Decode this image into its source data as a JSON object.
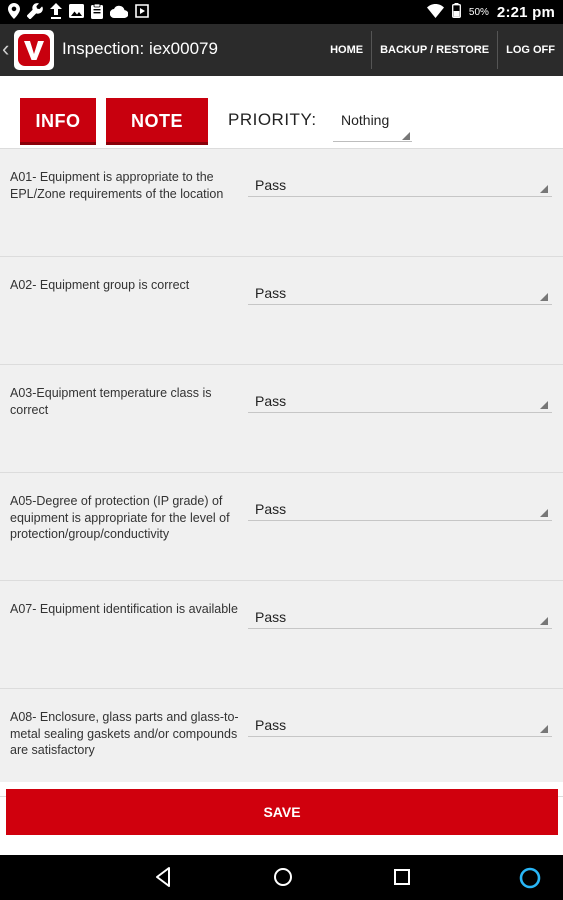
{
  "status_bar": {
    "battery": "50%",
    "time": "2:21 pm",
    "left_icons": [
      "location-pin-icon",
      "wrench-icon",
      "upload-icon",
      "image-icon",
      "clipboard-icon",
      "cloud-icon",
      "media-icon"
    ],
    "right_icons": [
      "wifi-icon",
      "battery-icon"
    ]
  },
  "app_bar": {
    "title": "Inspection: iex00079",
    "menu": [
      "HOME",
      "BACKUP / RESTORE",
      "LOG OFF"
    ],
    "colors": {
      "background": "#2b2b2b",
      "logo_red": "#c8000e"
    }
  },
  "tabs": {
    "info_label": "INFO",
    "note_label": "NOTE",
    "priority_label": "PRIORITY:",
    "priority_value": "Nothing"
  },
  "checklist": [
    {
      "question": "A01- Equipment is appropriate to the EPL/Zone requirements of the location",
      "result": "Pass"
    },
    {
      "question": "A02- Equipment group is correct",
      "result": "Pass"
    },
    {
      "question": "A03-Equipment temperature class is correct",
      "result": "Pass"
    },
    {
      "question": "A05-Degree of protection (IP grade) of equipment is appropriate for the level of protection/group/conductivity",
      "result": "Pass"
    },
    {
      "question": "A07- Equipment identification is available",
      "result": "Pass"
    },
    {
      "question": "A08- Enclosure, glass parts and glass-to-metal sealing gaskets and/or compounds are satisfactory",
      "result": "Pass"
    }
  ],
  "save_label": "SAVE",
  "nav_bar": [
    "back-icon",
    "home-icon",
    "recents-icon",
    "assistant-icon"
  ],
  "colors": {
    "accent": "#c8000e",
    "save": "#d0000d",
    "assistant": "#29b6f6"
  }
}
